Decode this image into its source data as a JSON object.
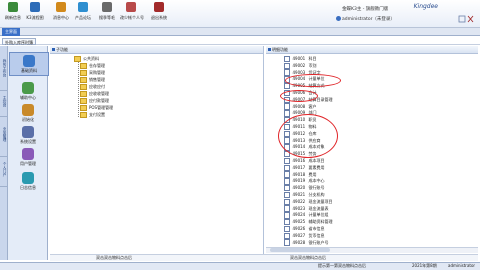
{
  "toolbar": {
    "buttons": [
      {
        "label": "刷新信息",
        "color": "#3b8a3b"
      },
      {
        "label": "K3流程图",
        "color": "#2d6cb8"
      },
      {
        "label": "消息中心",
        "color": "#d28a1c"
      },
      {
        "label": "产品论坛",
        "color": "#2f8fd0"
      },
      {
        "label": "搜季等毛",
        "color": "#6a6a6a"
      },
      {
        "label": "改少帐个人号",
        "color": "#b84a4a"
      },
      {
        "label": "退出系统",
        "color": "#a22b2b"
      }
    ],
    "brand": "Kingdee",
    "company": "金蝶K3主 - 旗舰教门版",
    "user": "administrator（未登录）"
  },
  "tabs": {
    "main": "主界面"
  },
  "breadcrumb": "外购入库序时簿",
  "vertical_tabs": [
    "我的工作台",
    "主控台",
    "业务管理",
    "个人门户"
  ],
  "modules": [
    {
      "label": "基础资料",
      "color": "#3a78c9",
      "selected": true
    },
    {
      "label": "辅助中心",
      "color": "#4a9a4a",
      "selected": false
    },
    {
      "label": "初始化",
      "color": "#c98a2a",
      "selected": false
    },
    {
      "label": "系统设置",
      "color": "#5a6fa8",
      "selected": false
    },
    {
      "label": "用户管理",
      "color": "#8a5ab8",
      "selected": false
    },
    {
      "label": "日志信息",
      "color": "#2a9ab0",
      "selected": false
    }
  ],
  "mid_panel": {
    "title": "子功能",
    "items": [
      "公共资料",
      "仓存管理",
      "采购管理",
      "销售管理",
      "应收应付",
      "应收收管理",
      "应付款管理",
      "POS管理管理",
      "支付设置"
    ]
  },
  "right_panel": {
    "title": "明细功能",
    "rows": [
      {
        "code": "49001",
        "name": "科目"
      },
      {
        "code": "49002",
        "name": "币别"
      },
      {
        "code": "49003",
        "name": "凭证字"
      },
      {
        "code": "49004",
        "name": "计量单位"
      },
      {
        "code": "49005",
        "name": "结算方式"
      },
      {
        "code": "49006",
        "name": "会计"
      },
      {
        "code": "49007",
        "name": "结算目录管理"
      },
      {
        "code": "49008",
        "name": "客户"
      },
      {
        "code": "49009",
        "name": "部门"
      },
      {
        "code": "49010",
        "name": "职员"
      },
      {
        "code": "49011",
        "name": "物料"
      },
      {
        "code": "49012",
        "name": "仓库"
      },
      {
        "code": "49013",
        "name": "供应商"
      },
      {
        "code": "49014",
        "name": "成本对象"
      },
      {
        "code": "49015",
        "name": "劳务"
      },
      {
        "code": "49016",
        "name": "成本项目"
      },
      {
        "code": "49017",
        "name": "要素费用"
      },
      {
        "code": "49018",
        "name": "费用"
      },
      {
        "code": "49019",
        "name": "成本中心"
      },
      {
        "code": "49020",
        "name": "银行账号"
      },
      {
        "code": "49021",
        "name": "分支机构"
      },
      {
        "code": "49022",
        "name": "现金流量项目"
      },
      {
        "code": "49023",
        "name": "现金流量表"
      },
      {
        "code": "49024",
        "name": "计量单位组"
      },
      {
        "code": "49025",
        "name": "辅助资料管理"
      },
      {
        "code": "49026",
        "name": "省市信息"
      },
      {
        "code": "49027",
        "name": "货币信息"
      },
      {
        "code": "49028",
        "name": "银行账户号"
      }
    ]
  },
  "hint": {
    "left": "双击双击物料点击后",
    "right": "双击双击物料点击后"
  },
  "status": {
    "text": "提示第一第双击物料点击后",
    "date": "2021年第8期",
    "user": "administrator"
  }
}
